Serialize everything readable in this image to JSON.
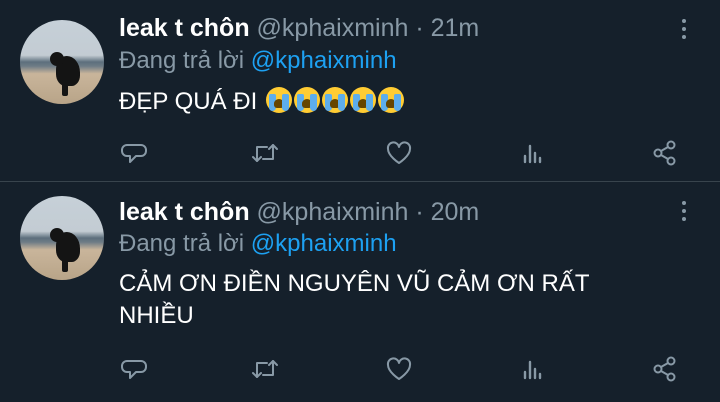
{
  "tweets": [
    {
      "name": "leak t chôn",
      "handle": "@kphaixminh",
      "separator": "·",
      "time": "21m",
      "reply_prefix": "Đang trả lời",
      "reply_to": "@kphaixminh",
      "text": "ĐẸP QUÁ ĐI",
      "emoji_count": 5,
      "emoji_name": "loudly-crying-face"
    },
    {
      "name": "leak t chôn",
      "handle": "@kphaixminh",
      "separator": "·",
      "time": "20m",
      "reply_prefix": "Đang trả lời",
      "reply_to": "@kphaixminh",
      "text": "CẢM ƠN ĐIỀN NGUYÊN VŨ CẢM ƠN RẤT NHIỀU"
    }
  ],
  "action_icons": [
    "comment-icon",
    "retweet-icon",
    "like-icon",
    "analytics-icon",
    "share-icon"
  ],
  "colors": {
    "background": "#15202b",
    "secondary_text": "#8899a6",
    "mention": "#1da1f2",
    "divider": "#38444d"
  }
}
